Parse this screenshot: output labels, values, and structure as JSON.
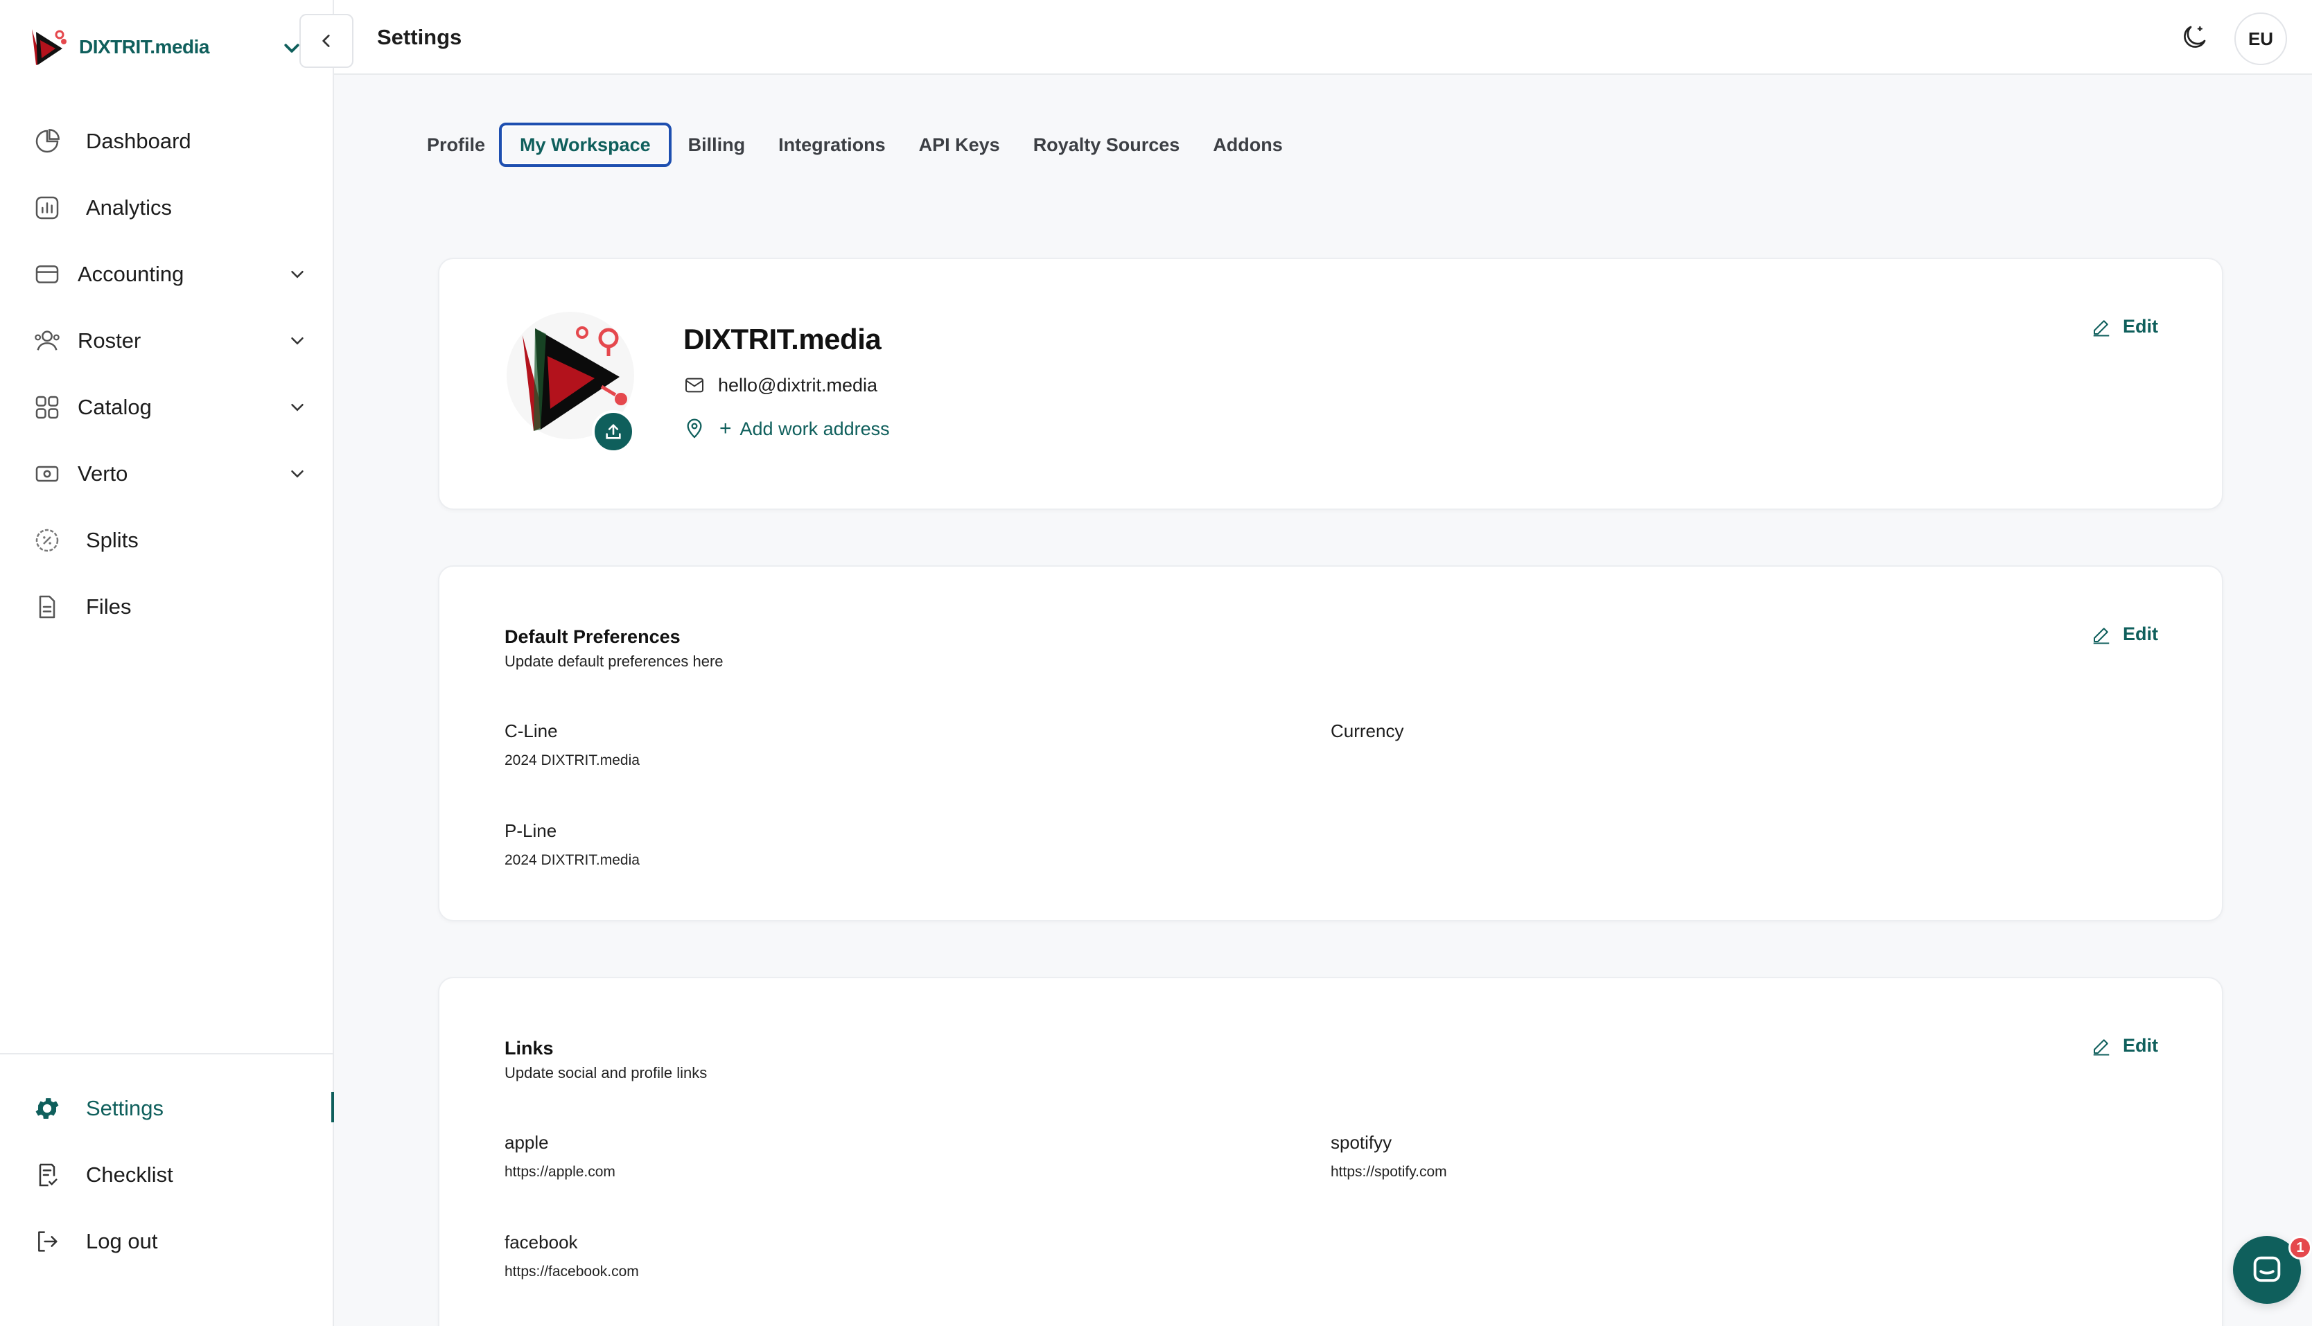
{
  "brand": {
    "name": "DIXTRIT.media",
    "accent": "#0f5f5c"
  },
  "sidebar": {
    "items": [
      {
        "label": "Dashboard"
      },
      {
        "label": "Analytics"
      },
      {
        "label": "Accounting"
      },
      {
        "label": "Roster"
      },
      {
        "label": "Catalog"
      },
      {
        "label": "Verto"
      },
      {
        "label": "Splits"
      },
      {
        "label": "Files"
      }
    ],
    "bottom_items": [
      {
        "label": "Settings"
      },
      {
        "label": "Checklist"
      },
      {
        "label": "Log out"
      }
    ]
  },
  "header": {
    "title": "Settings",
    "avatar_initials": "EU"
  },
  "tabs": [
    {
      "label": "Profile"
    },
    {
      "label": "My Workspace"
    },
    {
      "label": "Billing"
    },
    {
      "label": "Integrations"
    },
    {
      "label": "API Keys"
    },
    {
      "label": "Royalty Sources"
    },
    {
      "label": "Addons"
    }
  ],
  "workspace": {
    "name": "DIXTRIT.media",
    "email": "hello@dixtrit.media",
    "add_address_label": "Add work address",
    "edit_label": "Edit"
  },
  "preferences": {
    "title": "Default Preferences",
    "subtitle": "Update default preferences here",
    "edit_label": "Edit",
    "fields": [
      {
        "label": "C-Line",
        "value": "2024 DIXTRIT.media"
      },
      {
        "label": "Currency",
        "value": ""
      },
      {
        "label": "P-Line",
        "value": "2024 DIXTRIT.media"
      }
    ]
  },
  "links": {
    "title": "Links",
    "subtitle": "Update social and profile links",
    "edit_label": "Edit",
    "fields": [
      {
        "label": "apple",
        "value": "https://apple.com"
      },
      {
        "label": "spotifyy",
        "value": "https://spotify.com"
      },
      {
        "label": "facebook",
        "value": "https://facebook.com"
      }
    ]
  },
  "chat": {
    "badge_count": "1"
  }
}
